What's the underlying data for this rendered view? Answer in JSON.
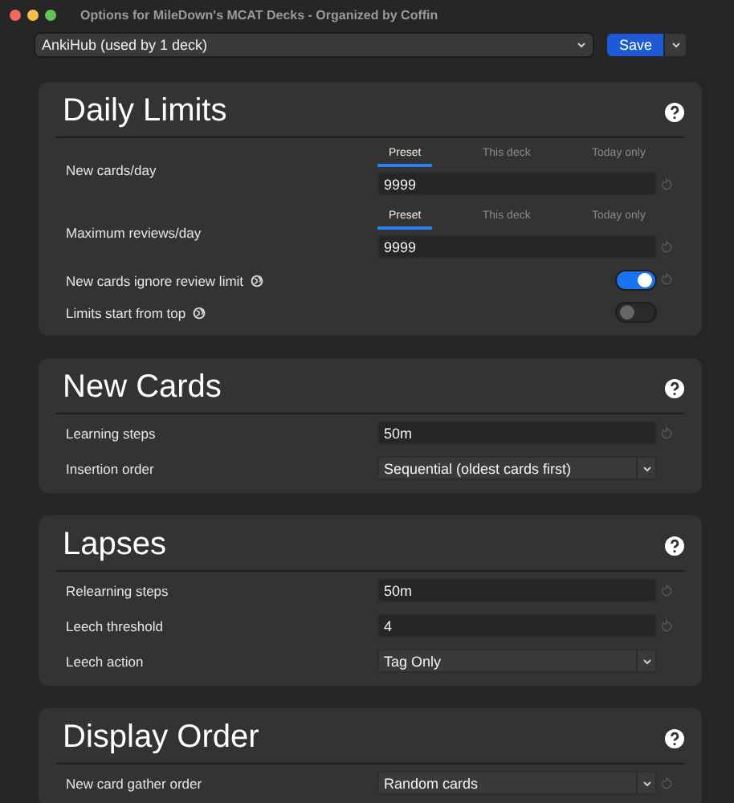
{
  "window": {
    "title": "Options for MileDown's MCAT Decks - Organized by Coffin"
  },
  "toolbar": {
    "preset_select": "AnkiHub (used by 1 deck)",
    "save_button": "Save"
  },
  "sections": [
    {
      "title": "Daily Limits",
      "rows": [
        {
          "kind": "tabbed",
          "label": "New cards/day",
          "tabs": [
            {
              "label": "Preset",
              "selected": true
            },
            {
              "label": "This deck",
              "selected": false
            },
            {
              "label": "Today only",
              "selected": false
            }
          ],
          "value": "9999",
          "reset": true
        },
        {
          "kind": "tabbed",
          "label": "Maximum reviews/day",
          "tabs": [
            {
              "label": "Preset",
              "selected": true
            },
            {
              "label": "This deck",
              "selected": false
            },
            {
              "label": "Today only",
              "selected": false
            }
          ],
          "value": "9999",
          "reset": true
        },
        {
          "kind": "toggle",
          "label": "New cards ignore review limit",
          "globe": true,
          "on": true,
          "reset": true
        },
        {
          "kind": "toggle",
          "label": "Limits start from top",
          "globe": true,
          "on": false,
          "reset": false
        }
      ]
    },
    {
      "title": "New Cards",
      "rows": [
        {
          "kind": "text",
          "label": "Learning steps",
          "value": "50m",
          "reset": true
        },
        {
          "kind": "select",
          "label": "Insertion order",
          "value": "Sequential (oldest cards first)",
          "reset": false
        }
      ]
    },
    {
      "title": "Lapses",
      "rows": [
        {
          "kind": "text",
          "label": "Relearning steps",
          "value": "50m",
          "reset": true
        },
        {
          "kind": "text",
          "label": "Leech threshold",
          "value": "4",
          "reset": true
        },
        {
          "kind": "select",
          "label": "Leech action",
          "value": "Tag Only",
          "reset": false
        }
      ]
    },
    {
      "title": "Display Order",
      "rows": [
        {
          "kind": "select",
          "label": "New card gather order",
          "value": "Random cards",
          "reset": true
        }
      ]
    }
  ]
}
